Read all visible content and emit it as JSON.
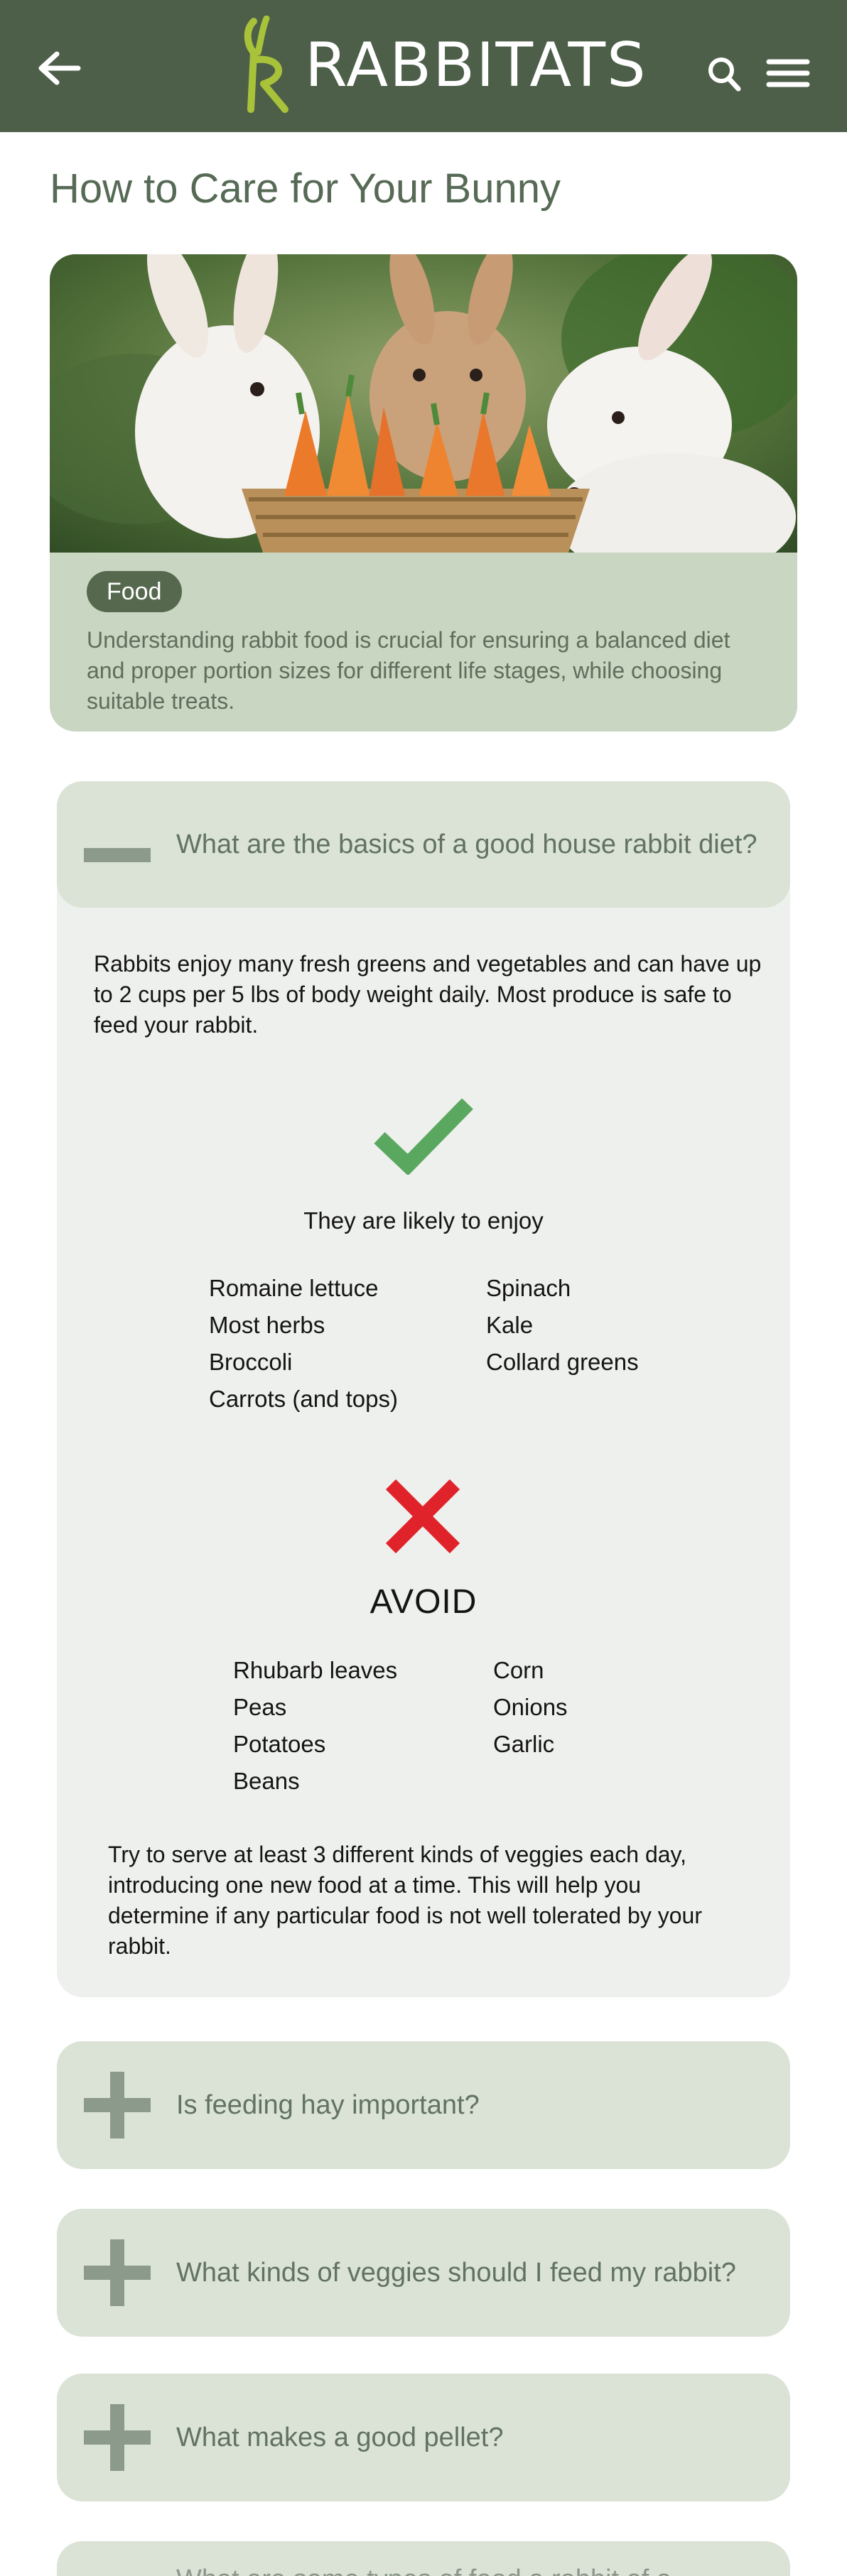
{
  "header": {
    "logo_text": "RABBITATS",
    "back_icon": "arrow-left-icon",
    "search_icon": "search-icon",
    "menu_icon": "hamburger-menu-icon",
    "background_color": "#4d5f49"
  },
  "page": {
    "title": "How to Care for Your Bunny"
  },
  "hero": {
    "image": "rabbits-eating-carrots-photo",
    "tag": "Food",
    "description": "Understanding rabbit food is crucial for ensuring a balanced diet and proper portion sizes for different life stages, while choosing suitable treats."
  },
  "faq": {
    "open_item": {
      "question": "What are the basics of a good house rabbit diet?",
      "intro": "Rabbits enjoy many fresh greens and vegetables and can have up to 2 cups per 5 lbs of body weight daily. Most produce is safe to feed your rabbit.",
      "enjoy_title": "They are likely to enjoy",
      "enjoy_col1": [
        "Romaine lettuce",
        "Most herbs",
        "Broccoli",
        "Carrots (and tops)"
      ],
      "enjoy_col2": [
        "Spinach",
        "Kale",
        "Collard greens"
      ],
      "avoid_title": "AVOID",
      "avoid_col1": [
        "Rhubarb leaves",
        "Peas",
        "Potatoes",
        "Beans"
      ],
      "avoid_col2": [
        "Corn",
        "Onions",
        "Garlic"
      ],
      "outro": "Try to serve at least 3 different kinds of veggies each day, introducing one new food at a time. This will help you determine if any particular food is not well tolerated by your rabbit."
    },
    "closed_items": [
      {
        "question": "Is feeding hay important?"
      },
      {
        "question": "What kinds of veggies should I feed my rabbit?"
      },
      {
        "question": "What makes a good pellet?"
      },
      {
        "question": "What are some types of food a rabbit of a..."
      }
    ],
    "check_color": "#5aa860",
    "cross_color": "#e0232a",
    "accordion_color": "#dae3d6"
  }
}
